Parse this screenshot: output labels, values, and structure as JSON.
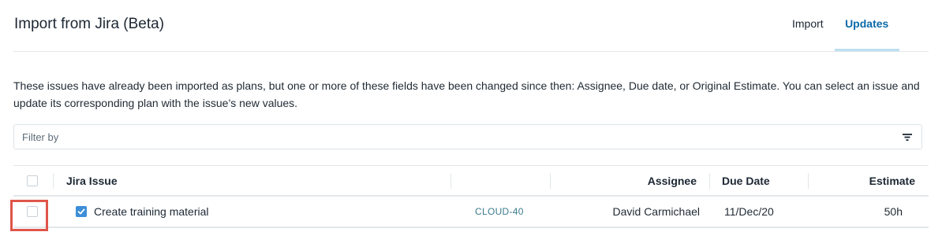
{
  "header": {
    "title": "Import from Jira (Beta)",
    "tabs": [
      {
        "label": "Import",
        "active": false
      },
      {
        "label": "Updates",
        "active": true
      }
    ]
  },
  "description": "These issues have already been imported as plans, but one or more of these fields have been changed since then: Assignee, Due date, or Original Estimate. You can select an issue and update its corresponding plan with the issue’s new values.",
  "filter": {
    "placeholder": "Filter by",
    "icon": "filter-icon"
  },
  "table": {
    "columns": {
      "issue": "Jira Issue",
      "key": "",
      "assignee": "Assignee",
      "due": "Due Date",
      "estimate": "Estimate"
    },
    "rows": [
      {
        "issue": "Create training material",
        "issue_checked": true,
        "row_selected": false,
        "key": "CLOUD-40",
        "assignee": "David Carmichael",
        "due": "11/Dec/20",
        "estimate": "50h"
      }
    ]
  },
  "colors": {
    "accent": "#0b6aa8",
    "checkbox": "#3d8ed8",
    "highlight": "#e0554a"
  }
}
